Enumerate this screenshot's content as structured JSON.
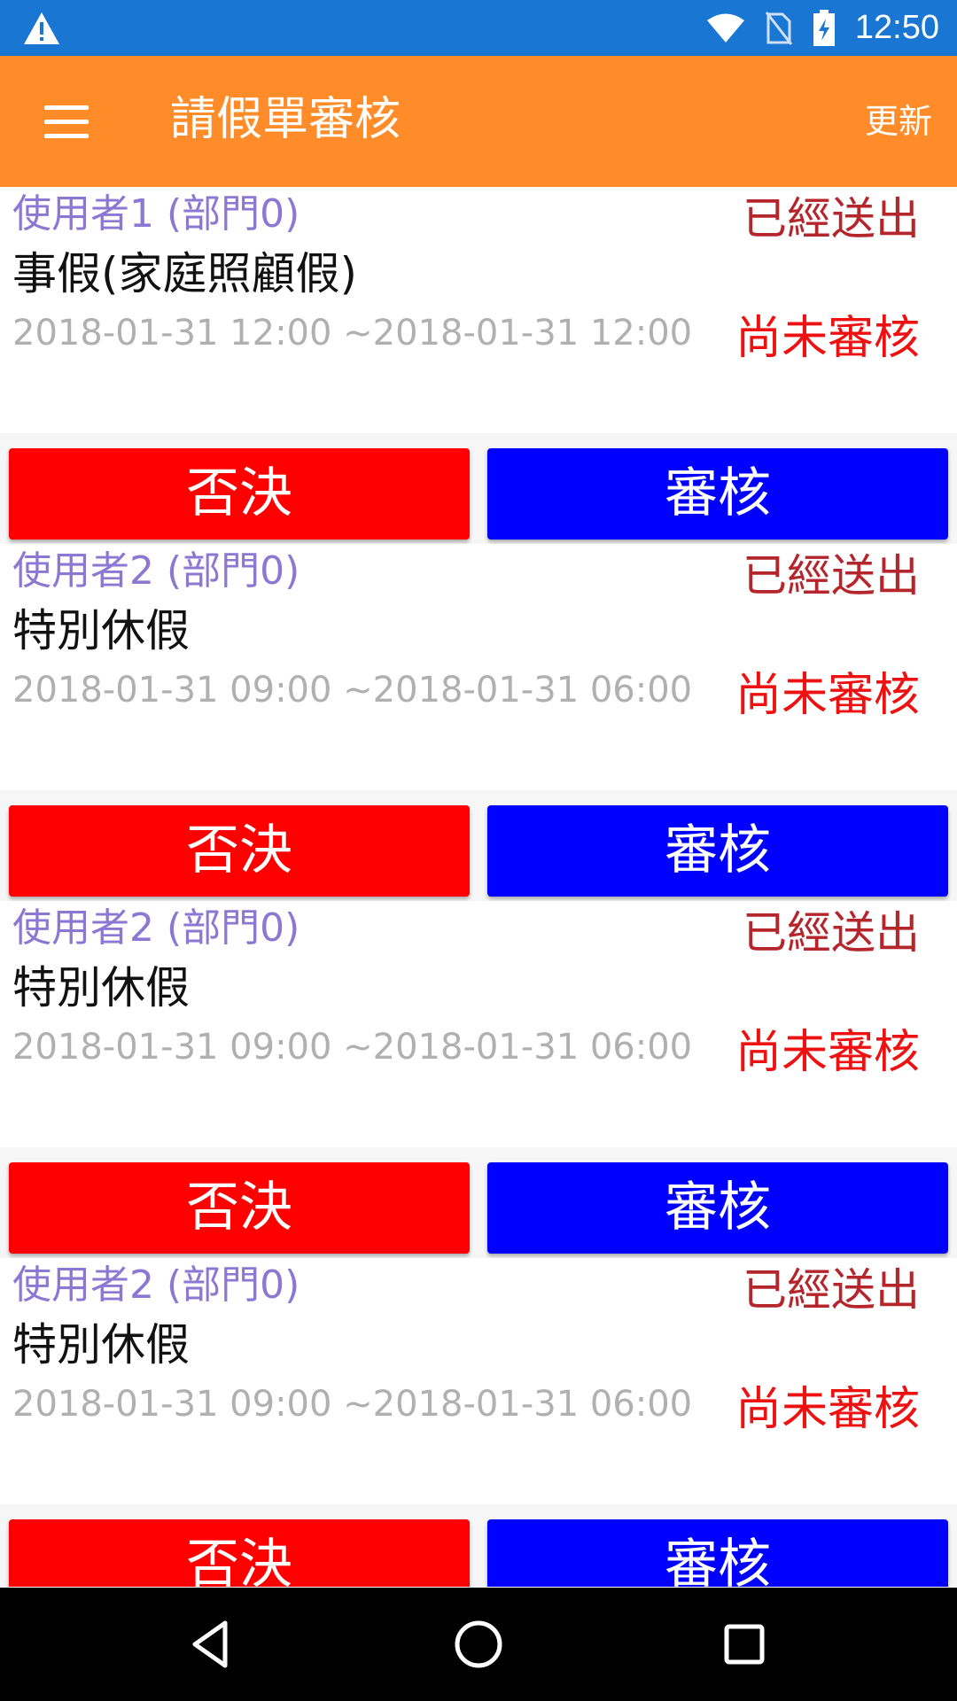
{
  "status_bar": {
    "time": "12:50",
    "icons": [
      "warning-icon",
      "wifi-icon",
      "no-sim-icon",
      "battery-charging-icon"
    ]
  },
  "app_bar": {
    "menu_icon": "menu-icon",
    "title": "請假單審核",
    "refresh_label": "更新"
  },
  "requests": [
    {
      "user": "使用者1 (部門0)",
      "type": "事假(家庭照顧假)",
      "date_range": "2018-01-31 12:00 ~2018-01-31 12:00",
      "sent_status": "已經送出",
      "review_status": "尚未審核",
      "reject_label": "否決",
      "approve_label": "審核"
    },
    {
      "user": "使用者2 (部門0)",
      "type": "特別休假",
      "date_range": "2018-01-31 09:00 ~2018-01-31 06:00",
      "sent_status": "已經送出",
      "review_status": "尚未審核",
      "reject_label": "否決",
      "approve_label": "審核"
    },
    {
      "user": "使用者2 (部門0)",
      "type": "特別休假",
      "date_range": "2018-01-31 09:00 ~2018-01-31 06:00",
      "sent_status": "已經送出",
      "review_status": "尚未審核",
      "reject_label": "否決",
      "approve_label": "審核"
    },
    {
      "user": "使用者2 (部門0)",
      "type": "特別休假",
      "date_range": "2018-01-31 09:00 ~2018-01-31 06:00",
      "sent_status": "已經送出",
      "review_status": "尚未審核",
      "reject_label": "否決",
      "approve_label": "審核"
    }
  ],
  "partial_row": {
    "reject_label": "否決",
    "approve_label": "審核"
  },
  "colors": {
    "status_bar": "#1976d2",
    "app_bar": "#ff8c28",
    "reject": "#ff0000",
    "approve": "#0000ff",
    "divider": "#f0a01a",
    "user_text": "#8a78d2",
    "sent_text": "#b5262c",
    "pending_text": "#ee1111"
  },
  "nav_bar": {
    "icons": [
      "back-icon",
      "home-icon",
      "recents-icon"
    ]
  }
}
